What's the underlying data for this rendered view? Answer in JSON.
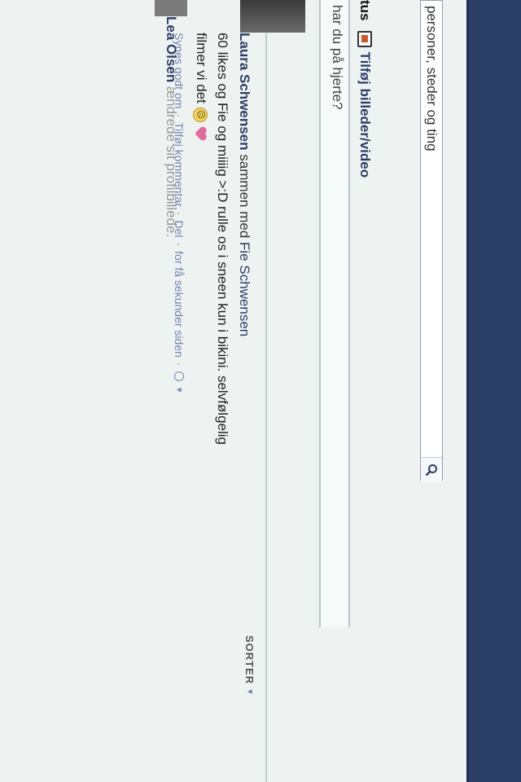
{
  "search": {
    "text": "personer, steder og ting"
  },
  "composer": {
    "tab_status_label": "tus",
    "tab_photo_label": "Tilføj billeder/video",
    "placeholder": "har du på hjerte?"
  },
  "feed": {
    "sort_label": "SORTER",
    "posts": [
      {
        "author": "Laura Schwensen",
        "with_text": "sammen med",
        "with_person": "Fie Schwensen",
        "text_1": "60 likes og Fie og miiiig >:D rulle os i sneen kun i bikini. selvfølgelig",
        "text_2": "filmer vi det",
        "actions": {
          "like": "Synes godt om",
          "comment": "Tilføj kommentar",
          "share": "Del",
          "time": "for få sekunder siden"
        }
      },
      {
        "author": "Lea Olsen",
        "text": "ændrede sit profilbillede."
      }
    ]
  },
  "colors": {
    "topbar": "#2b3f66",
    "link": "#2b3f66",
    "meta": "#6f86b0",
    "background": "#eef3f2"
  },
  "icons": [
    "search-icon",
    "photo-icon",
    "smiley-icon",
    "heart-icon",
    "globe-icon",
    "caret-down-icon"
  ]
}
